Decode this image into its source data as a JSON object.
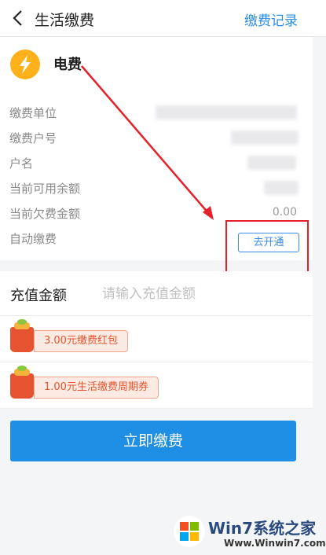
{
  "header": {
    "title": "生活缴费",
    "records_link": "缴费记录"
  },
  "service": {
    "name": "电费",
    "icon": "lightning-icon"
  },
  "details": [
    {
      "label": "缴费单位",
      "value": ""
    },
    {
      "label": "缴费户号",
      "value": ""
    },
    {
      "label": "户名",
      "value": ""
    },
    {
      "label": "当前可用余额",
      "value": ""
    },
    {
      "label": "当前欠费金额",
      "value": "0.00"
    },
    {
      "label": "自动缴费",
      "value": ""
    }
  ],
  "auto_pay_button": "去开通",
  "amount": {
    "label": "充值金额",
    "placeholder": "请输入充值金额"
  },
  "coupons": [
    {
      "text": "3.00元缴费红包"
    },
    {
      "text": "1.00元生活缴费周期券"
    }
  ],
  "pay_button": "立即缴费",
  "watermark": {
    "brand": "Win7系统之家",
    "url": "Www.Winwin7.com"
  },
  "colors": {
    "accent": "#1f8fe5",
    "link": "#2b8de6",
    "highlight": "#e5202a",
    "coupon": "#e5542c"
  }
}
